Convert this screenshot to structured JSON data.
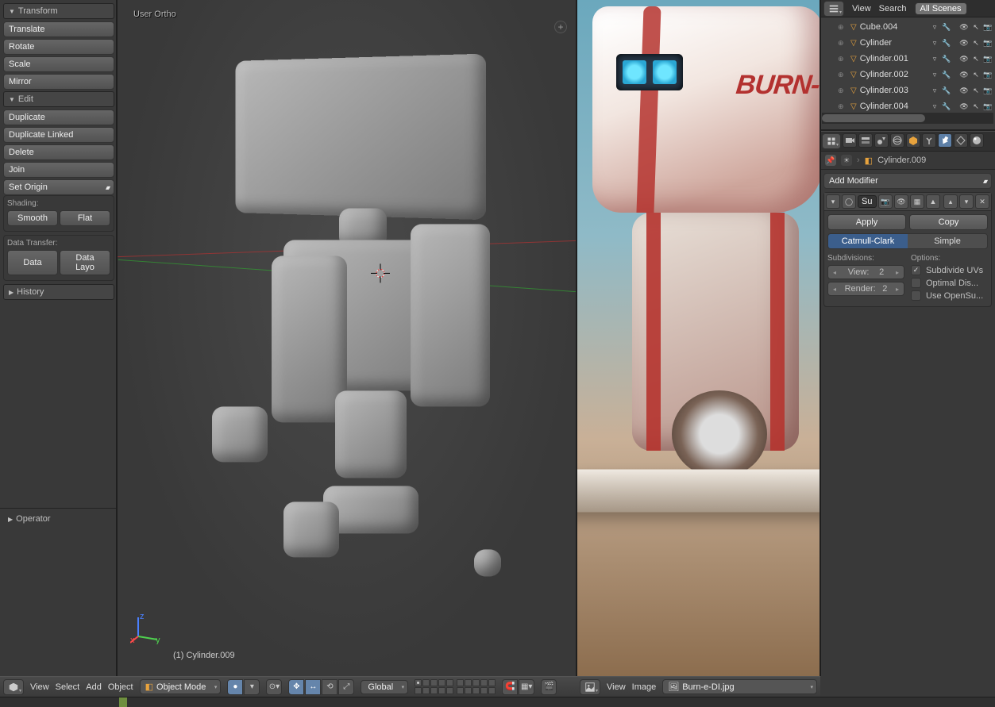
{
  "toolshelf": {
    "transform": {
      "header": "Transform",
      "translate": "Translate",
      "rotate": "Rotate",
      "scale": "Scale",
      "mirror": "Mirror"
    },
    "edit": {
      "header": "Edit",
      "duplicate": "Duplicate",
      "duplicate_linked": "Duplicate Linked",
      "delete": "Delete",
      "join": "Join",
      "set_origin": "Set Origin"
    },
    "shading": {
      "label": "Shading:",
      "smooth": "Smooth",
      "flat": "Flat"
    },
    "data_transfer": {
      "label": "Data Transfer:",
      "data": "Data",
      "data_layout": "Data Layo"
    },
    "history": {
      "header": "History"
    },
    "operator": {
      "header": "Operator"
    }
  },
  "viewport": {
    "label": "User Ortho",
    "active_object": "(1) Cylinder.009"
  },
  "view3d_header": {
    "menus": {
      "view": "View",
      "select": "Select",
      "add": "Add",
      "object": "Object"
    },
    "mode": "Object Mode",
    "orientation": "Global"
  },
  "image_header": {
    "menus": {
      "view": "View",
      "image": "Image"
    },
    "image_name": "Burn-e-DI.jpg"
  },
  "reference": {
    "logo_text": "BURN-"
  },
  "outliner": {
    "menus": {
      "view": "View",
      "search": "Search",
      "all_scenes": "All Scenes"
    },
    "items": [
      {
        "name": "Cube.004"
      },
      {
        "name": "Cylinder"
      },
      {
        "name": "Cylinder.001"
      },
      {
        "name": "Cylinder.002"
      },
      {
        "name": "Cylinder.003"
      },
      {
        "name": "Cylinder.004"
      }
    ]
  },
  "properties": {
    "breadcrumb_object": "Cylinder.009",
    "add_modifier": "Add Modifier",
    "subsurf": {
      "short_name": "Su",
      "apply": "Apply",
      "copy": "Copy",
      "type_catmull": "Catmull-Clark",
      "type_simple": "Simple",
      "subdiv_label": "Subdivisions:",
      "view_label": "View:",
      "view_value": "2",
      "render_label": "Render:",
      "render_value": "2",
      "options_label": "Options:",
      "opt_uvs": "Subdivide UVs",
      "opt_optimal": "Optimal Dis...",
      "opt_opensubdiv": "Use OpenSu..."
    }
  }
}
